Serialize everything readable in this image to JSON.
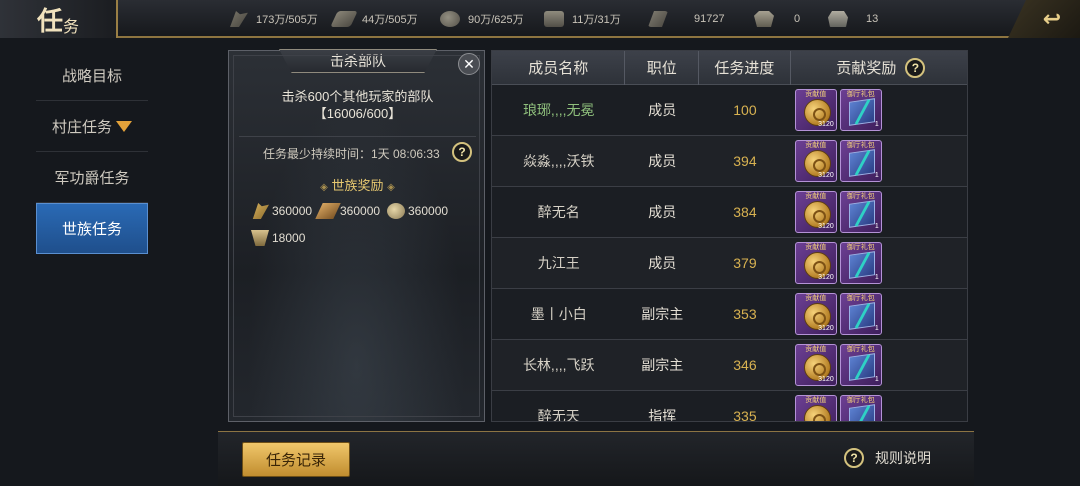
{
  "header": {
    "title_big": "任",
    "title_small": "务",
    "resources": [
      {
        "icon": "grain-icon",
        "value": "173万/505万"
      },
      {
        "icon": "wood-icon",
        "value": "44万/505万"
      },
      {
        "icon": "stone-icon",
        "value": "90万/625万"
      },
      {
        "icon": "iron-icon",
        "value": "11万/31万"
      },
      {
        "icon": "order-icon",
        "value": "91727"
      },
      {
        "icon": "gold-ingot-icon",
        "value": "0"
      },
      {
        "icon": "silver-ingot-icon",
        "value": "13"
      }
    ]
  },
  "sidebar": {
    "items": [
      {
        "label": "战略目标",
        "active": false
      },
      {
        "label": "村庄任务",
        "active": false,
        "dropdown": true
      },
      {
        "label": "军功爵任务",
        "active": false
      },
      {
        "label": "世族任务",
        "active": true
      }
    ]
  },
  "mission": {
    "tab_title": "击杀部队",
    "description_line1": "击杀600个其他玩家的部队",
    "description_line2": "【16006/600】",
    "duration": "任务最少持续时间：1天 08:06:33",
    "reward_title": "世族奖励",
    "rewards": [
      {
        "icon": "grain-icon",
        "value": "360000"
      },
      {
        "icon": "wood-icon",
        "value": "360000"
      },
      {
        "icon": "stone-icon",
        "value": "360000"
      },
      {
        "icon": "iron-icon",
        "value": "18000"
      }
    ]
  },
  "table": {
    "headers": [
      "成员名称",
      "职位",
      "任务进度",
      "贡献奖励"
    ],
    "reward_labels": {
      "coin": "贡献值",
      "gift": "御厅礼包"
    },
    "rows": [
      {
        "name": "琅琊,,,,无冕",
        "role": "成员",
        "progress": "100",
        "coin_count": "3120",
        "gift_count": "1",
        "self": true
      },
      {
        "name": "焱淼,,,,沃铁",
        "role": "成员",
        "progress": "394",
        "coin_count": "3120",
        "gift_count": "1",
        "self": false
      },
      {
        "name": "醉无名",
        "role": "成员",
        "progress": "384",
        "coin_count": "3120",
        "gift_count": "1",
        "self": false
      },
      {
        "name": "九江王",
        "role": "成员",
        "progress": "379",
        "coin_count": "3120",
        "gift_count": "1",
        "self": false
      },
      {
        "name": "墨丨小白",
        "role": "副宗主",
        "progress": "353",
        "coin_count": "3120",
        "gift_count": "1",
        "self": false
      },
      {
        "name": "长林,,,,飞跃",
        "role": "副宗主",
        "progress": "346",
        "coin_count": "3120",
        "gift_count": "1",
        "self": false
      },
      {
        "name": "醉无天",
        "role": "指挥",
        "progress": "335",
        "coin_count": "3120",
        "gift_count": "1",
        "self": false
      }
    ]
  },
  "bottom": {
    "record_label": "任务记录",
    "rules_label": "规则说明"
  },
  "help_glyph": "?",
  "close_glyph": "✕"
}
